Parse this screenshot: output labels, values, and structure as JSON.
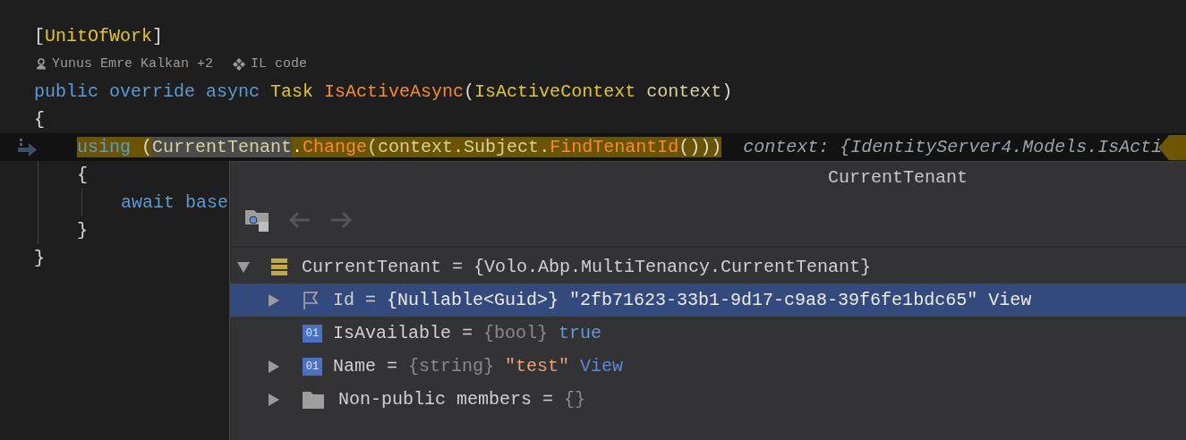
{
  "editor": {
    "lines": [
      {
        "kind": "code",
        "current": false,
        "tokens": [
          {
            "text": "[",
            "kind": "punct"
          },
          {
            "text": "UnitOfWork",
            "kind": "type"
          },
          {
            "text": "]",
            "kind": "punct"
          }
        ]
      },
      {
        "kind": "lens",
        "items": [
          {
            "text": "Yunus Emre Kalkan +2"
          },
          {
            "text": "IL code"
          }
        ]
      },
      {
        "kind": "code",
        "current": false,
        "tokens": [
          {
            "text": "public override async ",
            "kind": "keyword"
          },
          {
            "text": "Task ",
            "kind": "type"
          },
          {
            "text": "IsActiveAsync",
            "kind": "method"
          },
          {
            "text": "(",
            "kind": "punct"
          },
          {
            "text": "IsActiveContext ",
            "kind": "type"
          },
          {
            "text": "context",
            "kind": "param"
          },
          {
            "text": ")",
            "kind": "punct"
          }
        ]
      },
      {
        "kind": "code",
        "current": false,
        "tokens": [
          {
            "text": "{",
            "kind": "punct"
          }
        ]
      },
      {
        "kind": "block",
        "children": [
          {
            "kind": "code",
            "current": true,
            "hint": "context: {IdentityServer4.Models.IsActi",
            "tokens": [
              {
                "text": "using",
                "kind": "keyword",
                "highlighted": true,
                "symbol_match": false
              },
              {
                "text": " (",
                "kind": "punct",
                "highlighted": true,
                "symbol_match": false
              },
              {
                "text": "CurrentTenant",
                "kind": "param",
                "highlighted": true,
                "symbol_match": true
              },
              {
                "text": ".",
                "kind": "punct",
                "highlighted": true,
                "symbol_match": false
              },
              {
                "text": "Change",
                "kind": "method",
                "highlighted": true,
                "symbol_match": false
              },
              {
                "text": "(context.Subject.",
                "kind": "param",
                "highlighted": true,
                "symbol_match": false
              },
              {
                "text": "FindTenantId",
                "kind": "method",
                "highlighted": true,
                "symbol_match": false
              },
              {
                "text": "()))",
                "kind": "punct",
                "highlighted": true,
                "symbol_match": false
              }
            ]
          },
          {
            "kind": "code",
            "current": false,
            "tokens": [
              {
                "text": "{",
                "kind": "punct"
              }
            ]
          },
          {
            "kind": "block",
            "children": [
              {
                "kind": "code",
                "current": false,
                "tokens": [
                  {
                    "text": "await base",
                    "kind": "keyword"
                  }
                ]
              }
            ]
          },
          {
            "kind": "code",
            "current": false,
            "tokens": [
              {
                "text": "}",
                "kind": "punct"
              }
            ]
          }
        ]
      },
      {
        "kind": "code",
        "current": false,
        "tokens": [
          {
            "text": "}",
            "kind": "punct"
          }
        ]
      }
    ]
  },
  "popup": {
    "title": "CurrentTenant",
    "back_disabled": true,
    "forward_disabled": true,
    "root": {
      "name": "CurrentTenant",
      "sep": "=",
      "value": {
        "text": "{Volo.Abp.MultiTenancy.CurrentTenant}"
      },
      "kind": "class",
      "expanded": true,
      "selected": false,
      "children": [
        {
          "name": "Id",
          "sep": "=",
          "type": "{Nullable<Guid>}",
          "value": {
            "text": "\"2fb71623-33b1-9d17-c9a8-39f6fe1bdc65\"",
            "kind": "string"
          },
          "link": "View",
          "kind": "property",
          "expanded": false,
          "selected": true
        },
        {
          "name": "IsAvailable",
          "sep": "=",
          "type": "{bool}",
          "value": {
            "text": "true",
            "kind": "bool"
          },
          "kind": "field",
          "icon_label": "01",
          "selected": false
        },
        {
          "name": "Name",
          "sep": "=",
          "type": "{string}",
          "value": {
            "text": "\"test\"",
            "kind": "string"
          },
          "link": "View",
          "kind": "field",
          "icon_label": "01",
          "expanded": false,
          "selected": false
        },
        {
          "name": "Non-public members",
          "sep": "=",
          "type": "{}",
          "kind": "group",
          "expanded": false,
          "selected": false
        }
      ]
    }
  }
}
